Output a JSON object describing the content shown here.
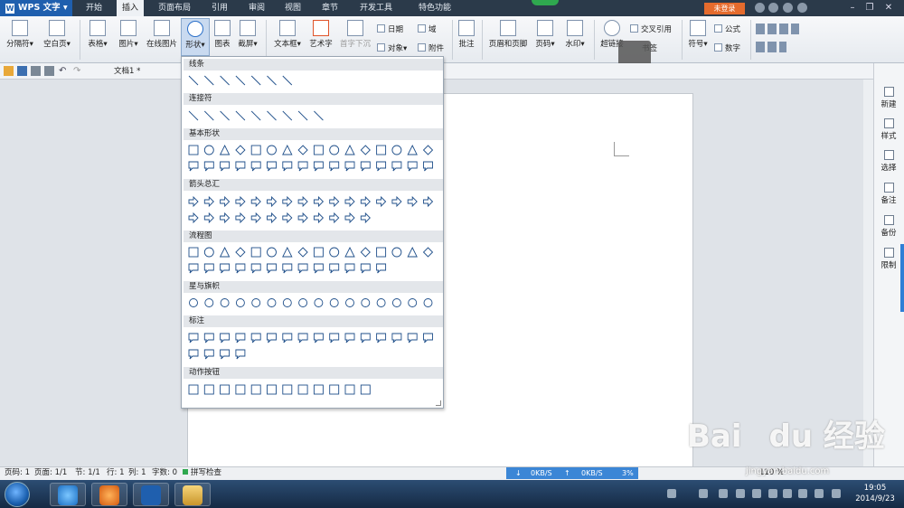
{
  "app": {
    "name": "WPS 文字",
    "login": "未登录"
  },
  "menu_tabs": [
    "开始",
    "插入",
    "页面布局",
    "引用",
    "审阅",
    "视图",
    "章节",
    "开发工具",
    "特色功能"
  ],
  "ribbon": {
    "buttons": [
      "分隔符",
      "空白页",
      "表格",
      "图片",
      "在线图片",
      "形状",
      "图表",
      "截屏",
      "文本框",
      "艺术字",
      "首字下沉",
      "批注",
      "页眉和页脚",
      "页码",
      "水印",
      "超链接",
      "书签",
      "符号",
      "公式",
      "数字"
    ],
    "small": [
      "日期",
      "域",
      "对象",
      "附件",
      "交叉引用",
      "公式"
    ]
  },
  "doc_tab": "文档1 *",
  "shape_panel": {
    "categories": [
      "线条",
      "连接符",
      "基本形状",
      "箭头总汇",
      "流程图",
      "星与旗帜",
      "标注",
      "动作按钮"
    ]
  },
  "right_panel": [
    "新建",
    "样式",
    "选择",
    "备注",
    "备份",
    "限制"
  ],
  "status": {
    "page": "页码: 1",
    "pages": "页面: 1/1",
    "section": "节: 1/1",
    "row": "行: 1",
    "col": "列: 1",
    "words": "字数: 0",
    "spell": "拼写检查",
    "down": "0KB/S",
    "up": "0KB/S",
    "pct": "3%",
    "zoom": "110 %"
  },
  "clock": {
    "time": "19:05",
    "date": "2014/9/23"
  },
  "watermark": {
    "brand": "Bai du 经验",
    "url": "jingyan.baidu.com"
  }
}
